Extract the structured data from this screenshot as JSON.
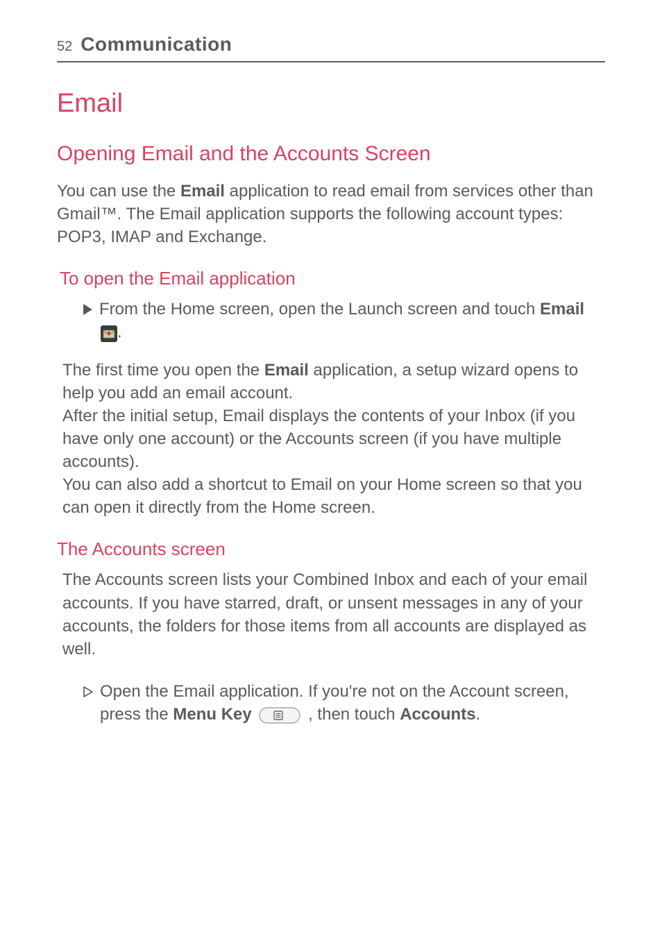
{
  "header": {
    "page_number": "52",
    "chapter": "Communication"
  },
  "main_heading": "Email",
  "section1": {
    "heading": "Opening Email and the Accounts Screen",
    "intro_pre": "You can use the ",
    "intro_bold": "Email",
    "intro_post": " application to read email from services other than Gmail™. The Email application supports the following account types: POP3, IMAP and Exchange."
  },
  "subsection1": {
    "heading": "To open the Email application",
    "bullet_pre": "From the Home screen, open the Launch screen and touch ",
    "bullet_bold": "Email",
    "bullet_post": "."
  },
  "paragraph_block": {
    "p1_pre": "The first time you open the ",
    "p1_bold": "Email",
    "p1_post": " application, a setup wizard opens to help you add an email account.",
    "p2": "After the initial setup, Email displays the contents of your Inbox (if you have only one account) or the Accounts screen (if you have multiple accounts).",
    "p3": "You can also add a shortcut to Email on your Home screen so that you can open it directly from the Home screen."
  },
  "subsection2": {
    "heading": "The Accounts screen",
    "body": "The Accounts screen lists your Combined Inbox and each of your email accounts. If you have starred, draft, or unsent messages in any of your accounts, the folders for those items from all accounts are displayed as well.",
    "bullet_pre": "Open the Email application. If you're not on the Account screen, press the ",
    "bullet_bold1": "Menu Key",
    "bullet_mid": " , then touch ",
    "bullet_bold2": "Accounts",
    "bullet_post": "."
  }
}
